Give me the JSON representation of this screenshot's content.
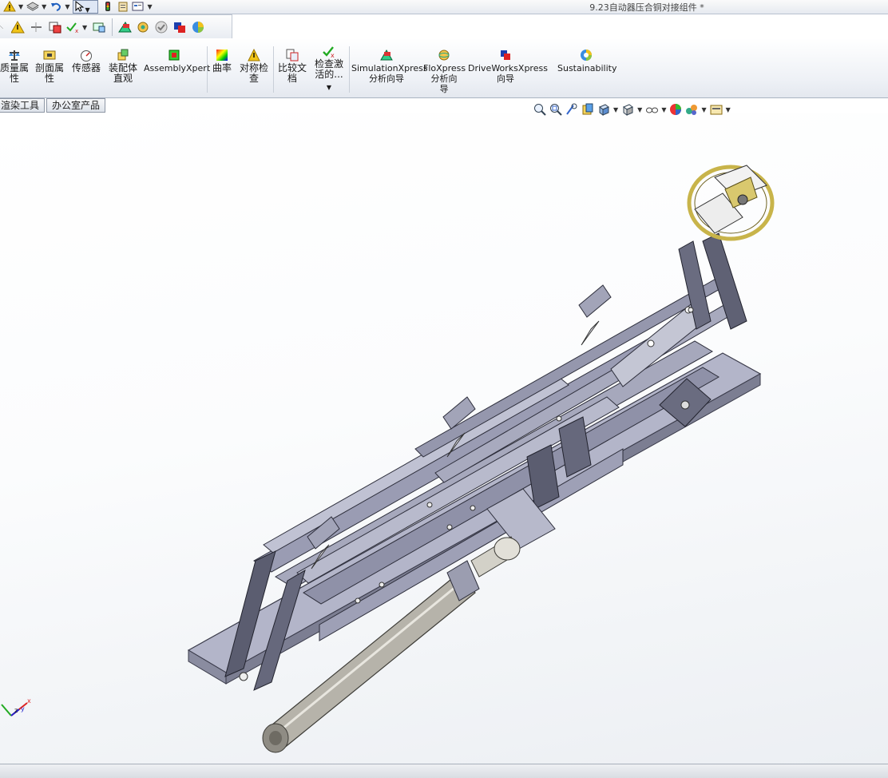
{
  "window": {
    "title": "9.23自动器压合铜对接组件 *"
  },
  "quick_access": {
    "icons": [
      "warning-icon",
      "layers-icon",
      "undo-icon",
      "select-pointer-icon",
      "traffic-light-icon",
      "clipboard-icon",
      "file-properties-icon"
    ]
  },
  "toolbar2": {
    "icons": [
      "measure-icon",
      "warning-icon",
      "move-icon",
      "section-icon",
      "check-icon",
      "assembly-icon",
      "simulation-icon",
      "gear-icon",
      "check-circle-icon",
      "colors-icon",
      "sustainability-icon"
    ]
  },
  "ribbon": {
    "items": [
      {
        "label": "质量属\n性"
      },
      {
        "label": "剖面属\n性"
      },
      {
        "label": "传感器"
      },
      {
        "label": "装配体\n直观"
      },
      {
        "label": "AssemblyXpert"
      },
      {
        "label": "曲率"
      },
      {
        "label": "对称检\n查"
      },
      {
        "label": "比较文\n档"
      },
      {
        "label": "检查激\n活的..."
      },
      {
        "label": "SimulationXpress\n分析向导"
      },
      {
        "label": "FloXpress\n分析向\n导"
      },
      {
        "label": "DriveWorksXpress\n向导"
      },
      {
        "label": "Sustainability"
      }
    ]
  },
  "tabs": [
    {
      "label": "渲染工具"
    },
    {
      "label": "办公室产品"
    }
  ],
  "view_toolbar": {
    "icons": [
      "zoom-to-fit-icon",
      "zoom-area-icon",
      "previous-view-icon",
      "section-view-icon",
      "view-orientation-icon",
      "display-style-icon",
      "hide-show-icon",
      "appearance-icon",
      "scene-icon",
      "view-settings-icon"
    ]
  },
  "triad": {
    "x": "x",
    "y": "y",
    "z": "z"
  },
  "colors": {
    "accent": "#1e5fb4",
    "model_gray": "#a4a6b8",
    "model_dark": "#5a5c6e",
    "ring_gold": "#c8b44a"
  }
}
